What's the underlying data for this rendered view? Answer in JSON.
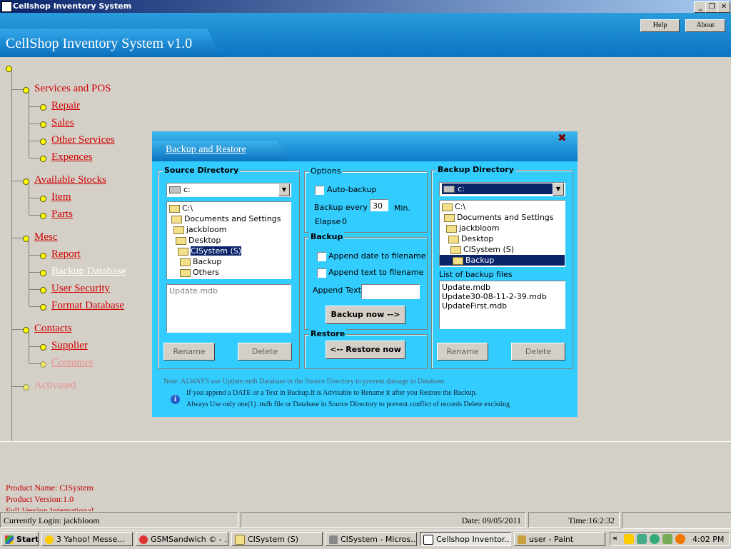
{
  "window": {
    "title": "Cellshop Inventory System"
  },
  "header": {
    "app_title": "CellShop Inventory System v1.0",
    "help_label": "Help",
    "about_label": "About"
  },
  "tree": {
    "groups": [
      {
        "label": "Services  and POS",
        "items": [
          "Repair",
          "Sales",
          "Other Services",
          "Expences"
        ]
      },
      {
        "label": "Available Stocks",
        "items": [
          "Item",
          "Parts"
        ]
      },
      {
        "label": "Mesc",
        "items": [
          "Report",
          "Backup Database",
          "User Security",
          "Format Database"
        ]
      },
      {
        "label": "Contacts",
        "items": [
          "Supplier",
          "Costumer"
        ]
      },
      {
        "label": "Activated",
        "items": []
      }
    ]
  },
  "product_info": {
    "name": "Product Name:   CISystem",
    "version": "Product Version:1.0",
    "edition": "Full Version International"
  },
  "status_bar": {
    "login": "Currently Login: jackbloom",
    "date": "Date: 09/05/2011",
    "time": "Time:16:2:32"
  },
  "dialog": {
    "title": "Backup and Restore",
    "source": {
      "label": "Source Directory",
      "drive": "c:",
      "folders": [
        "C:\\",
        "Documents and Settings",
        "jackbloom",
        "Desktop",
        "CISystem (S)",
        "Backup",
        "Others"
      ],
      "selected": "CISystem (S)",
      "files": [
        "Update.mdb"
      ],
      "rename_label": "Rename",
      "delete_label": "Delete"
    },
    "options": {
      "label": "Options",
      "auto_backup_label": "Auto-backup",
      "backup_every_label": "Backup every",
      "backup_every_value": "30",
      "min_label": "Min.",
      "elapse_label": "Elapse",
      "elapse_value": "0"
    },
    "backup": {
      "label": "Backup",
      "append_date_label": "Append date to filename",
      "append_text_label": "Append text to filename",
      "append_text_field_label": "Append Text",
      "append_text_value": "",
      "backup_now_label": "Backup now -->"
    },
    "restore": {
      "label": "Restore",
      "restore_now_label": "<-- Restore now"
    },
    "backup_dir": {
      "label": "Backup Directory",
      "drive": "c:",
      "folders": [
        "C:\\",
        "Documents and Settings",
        "jackbloom",
        "Desktop",
        "CISystem (S)",
        "Backup"
      ],
      "selected": "Backup",
      "files_label": "List of backup files",
      "files": [
        "Update.mdb",
        "Update30-08-11-2-39.mdb",
        "UpdateFirst.mdb"
      ],
      "rename_label": "Rename",
      "delete_label": "Delete"
    },
    "notes": {
      "note": "Note: ALWAYS use Update.mdb Database in the Source Directory to prevent damage in Database.",
      "line1": "If you append a DATE or a Text in Backup.It is Advisable to Rename it after you Restore the Backup.",
      "line2": "Always Use only one(1) .mdb file or Database in Source Directory to prevent conflict of records Delete excisting"
    }
  },
  "taskbar": {
    "start_label": "Start",
    "items": [
      "3 Yahoo! Messe...",
      "GSMSandwich © - ...",
      "CISystem (S)",
      "CISystem - Micros...",
      "Cellshop Inventor...",
      "user - Paint"
    ],
    "clock": "4:02 PM"
  }
}
